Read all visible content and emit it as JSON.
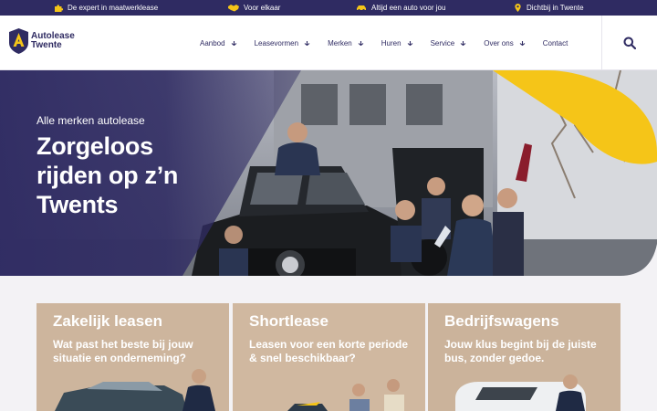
{
  "topbar": {
    "usps": [
      {
        "icon": "puzzle-icon",
        "text": "De expert in maatwerklease"
      },
      {
        "icon": "handshake-icon",
        "text": "Voor elkaar"
      },
      {
        "icon": "car-icon",
        "text": "Altijd een auto voor jou"
      },
      {
        "icon": "location-pin-icon",
        "text": "Dichtbij in Twente"
      }
    ],
    "accent": "#f5c518",
    "background": "#2f2b62"
  },
  "header": {
    "logo_line1": "Autolease",
    "logo_line2": "Twente",
    "nav": [
      {
        "label": "Aanbod",
        "dropdown": true
      },
      {
        "label": "Leasevormen",
        "dropdown": true
      },
      {
        "label": "Merken",
        "dropdown": true
      },
      {
        "label": "Huren",
        "dropdown": true
      },
      {
        "label": "Service",
        "dropdown": true
      },
      {
        "label": "Over ons",
        "dropdown": true
      },
      {
        "label": "Contact",
        "dropdown": false
      }
    ],
    "search_icon": "search-icon"
  },
  "hero": {
    "eyebrow": "Alle merken autolease",
    "title_lines": [
      "Zorgeloos",
      "rijden op z’n",
      "Twents"
    ],
    "accent": "#f5c518"
  },
  "cards": [
    {
      "title": "Zakelijk leasen",
      "subtitle": "Wat past het beste bij jouw situatie en onderneming?"
    },
    {
      "title": "Shortlease",
      "subtitle": "Leasen voor een korte periode & snel beschikbaar?"
    },
    {
      "title": "Bedrijfswagens",
      "subtitle": "Jouw klus begint bij de juiste bus, zonder gedoe."
    }
  ]
}
